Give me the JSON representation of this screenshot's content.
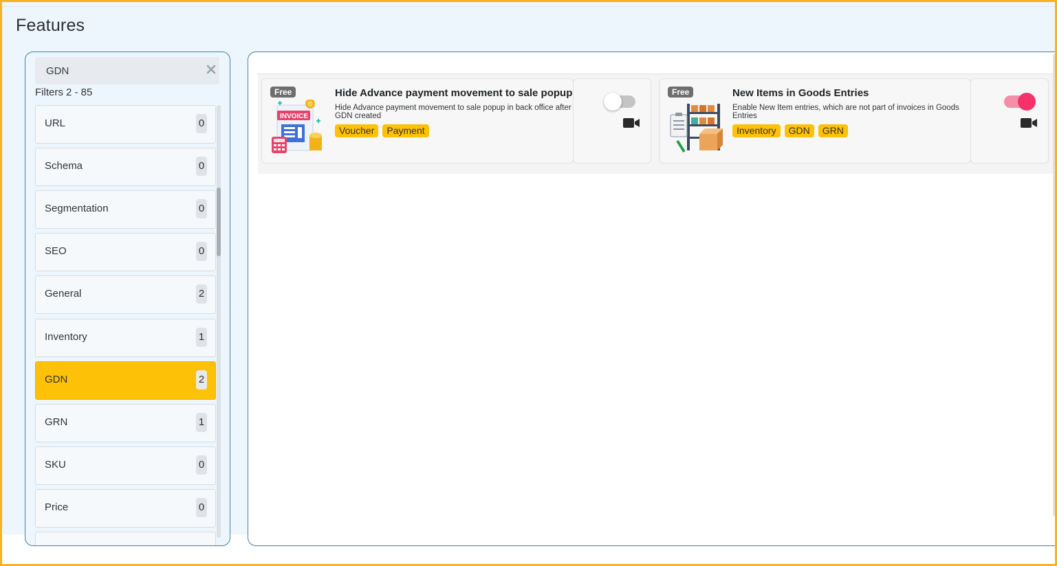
{
  "page": {
    "title": "Features"
  },
  "filter": {
    "search_value": "GDN",
    "count_text": "Filters 2 - 85",
    "items": [
      {
        "label": "URL",
        "count": "0",
        "active": false
      },
      {
        "label": "Schema",
        "count": "0",
        "active": false
      },
      {
        "label": "Segmentation",
        "count": "0",
        "active": false
      },
      {
        "label": "SEO",
        "count": "0",
        "active": false
      },
      {
        "label": "General",
        "count": "2",
        "active": false
      },
      {
        "label": "Inventory",
        "count": "1",
        "active": false
      },
      {
        "label": "GDN",
        "count": "2",
        "active": true
      },
      {
        "label": "GRN",
        "count": "1",
        "active": false
      },
      {
        "label": "SKU",
        "count": "0",
        "active": false
      },
      {
        "label": "Price",
        "count": "0",
        "active": false
      }
    ]
  },
  "features": [
    {
      "badge": "Free",
      "title": "Hide Advance payment movement to sale popup",
      "description": "Hide Advance payment movement to sale popup in back office after GDN created",
      "image_text": "INVOICE",
      "tags": [
        "Voucher",
        "Payment"
      ],
      "enabled": false,
      "icon": "video-camera-icon"
    },
    {
      "badge": "Free",
      "title": "New Items in Goods Entries",
      "description": "Enable New Item entries, which are not part of invoices in Goods Entries",
      "tags": [
        "Inventory",
        "GDN",
        "GRN"
      ],
      "enabled": true,
      "icon": "video-camera-icon"
    }
  ],
  "colors": {
    "accent": "#fdc107",
    "frame_border": "#f5b324",
    "panel_border": "#3f7fa5",
    "toggle_on": "#f5326a"
  }
}
